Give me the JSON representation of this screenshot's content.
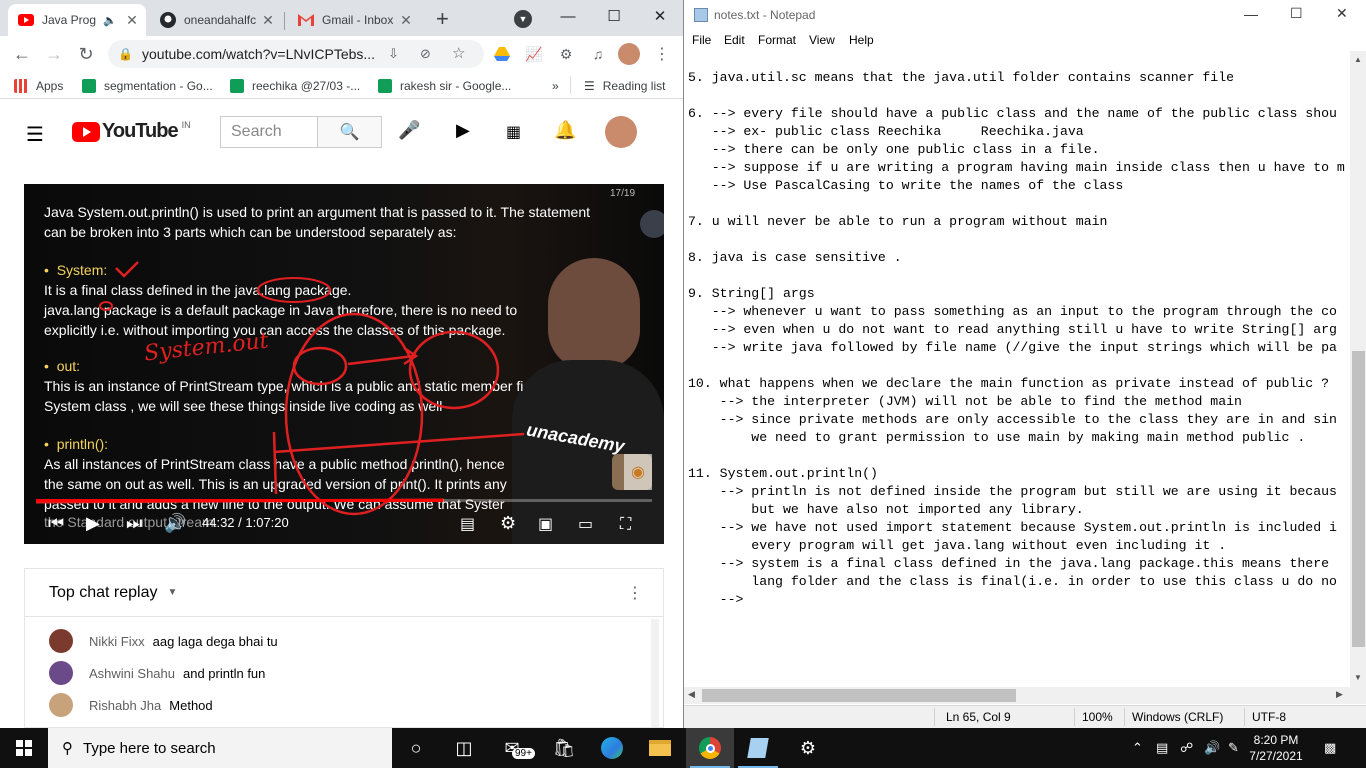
{
  "chrome": {
    "tabs": [
      {
        "label": "Java Prog",
        "icon": "youtube-icon",
        "active": true
      },
      {
        "label": "oneandahalfc",
        "icon": "github-icon",
        "active": false
      },
      {
        "label": "Gmail - Inbox",
        "icon": "gmail-icon",
        "active": false
      }
    ],
    "new_tab": "+",
    "url": "youtube.com/watch?v=LNvICPTebs...",
    "bookmarks": [
      {
        "label": "Apps",
        "icon": "apps-grid-icon"
      },
      {
        "label": "segmentation - Go...",
        "icon": "sheets-icon"
      },
      {
        "label": "reechika @27/03 -...",
        "icon": "sheets-icon"
      },
      {
        "label": "rakesh sir - Google...",
        "icon": "sheets-icon"
      }
    ],
    "more_bookmarks": "»",
    "reading_list": "Reading list"
  },
  "youtube": {
    "logo": "YouTube",
    "country": "IN",
    "search_placeholder": "Search",
    "video": {
      "slide_counter": "17/19",
      "line1": "Java System.out.println() is used to print an argument that is passed to it. The statement",
      "line2": "can be broken into 3 parts which can be understood separately as:",
      "b1_title": "System:",
      "b1_l1": "It is a final class defined in the java.lang package.",
      "b1_l2": "java.lang package is a default package in Java therefore, there is no need to",
      "b1_l3": "explicitly i.e. without importing you can access the classes of this package.",
      "b2_title": "out:",
      "b2_l1": "This is an instance of PrintStream type, which is a public and static member fi",
      "b2_l2": "System class , we will see these things inside live coding as well",
      "b3_title": "println():",
      "b3_l1": "As all instances of PrintStream class have a public method println(), hence",
      "b3_l2": "the same on out as well. This is an upgraded version of print(). It prints any",
      "b3_l3": "passed to it and adds a new line to the output. We can assume that Syster",
      "b3_l4": "the Standard output stream.",
      "annotation": "System.out",
      "watermark": "unacademy",
      "time": "44:32 / 1:07:20",
      "progress": 0.661
    },
    "chat": {
      "title": "Top chat replay",
      "messages": [
        {
          "author": "Nikki Fixx",
          "text": "aag laga dega bhai tu",
          "color": "#7a3b2e"
        },
        {
          "author": "Ashwini Shahu",
          "text": "and println fun",
          "color": "#6b4a8a"
        },
        {
          "author": "Rishabh Jha",
          "text": "Method",
          "color": "#c8a27a"
        }
      ]
    }
  },
  "notepad": {
    "title": "notes.txt - Notepad",
    "menu": [
      "File",
      "Edit",
      "Format",
      "View",
      "Help"
    ],
    "lines": [
      "5. java.util.sc means that the java.util folder contains scanner file",
      "",
      "6. --> every file should have a public class and the name of the public class shou",
      "   --> ex- public class Reechika     Reechika.java",
      "   --> there can be only one public class in a file.",
      "   --> suppose if u are writing a program having main inside class then u have to m",
      "   --> Use PascalCasing to write the names of the class",
      "",
      "7. u will never be able to run a program without main",
      "",
      "8. java is case sensitive .",
      "",
      "9. String[] args",
      "   --> whenever u want to pass something as an input to the program through the co",
      "   --> even when u do not want to read anything still u have to write String[] arg",
      "   --> write java followed by file name (//give the input strings which will be pa",
      "",
      "10. what happens when we declare the main function as private instead of public ?",
      "    --> the interpreter (JVM) will not be able to find the method main",
      "    --> since private methods are only accessible to the class they are in and sin",
      "        we need to grant permission to use main by making main method public .",
      "",
      "11. System.out.println()",
      "    --> println is not defined inside the program but still we are using it becaus",
      "        but we have also not imported any library.",
      "    --> we have not used import statement because System.out.println is included i",
      "        every program will get java.lang without even including it .",
      "    --> system is a final class defined in the java.lang package.this means there",
      "        lang folder and the class is final(i.e. in order to use this class u do no",
      "    -->"
    ],
    "status": {
      "position": "Ln 65, Col 9",
      "zoom": "100%",
      "eol": "Windows (CRLF)",
      "encoding": "UTF-8"
    }
  },
  "taskbar": {
    "search_placeholder": "Type here to search",
    "mail_badge": "99+",
    "time": "8:20 PM",
    "date": "7/27/2021"
  }
}
